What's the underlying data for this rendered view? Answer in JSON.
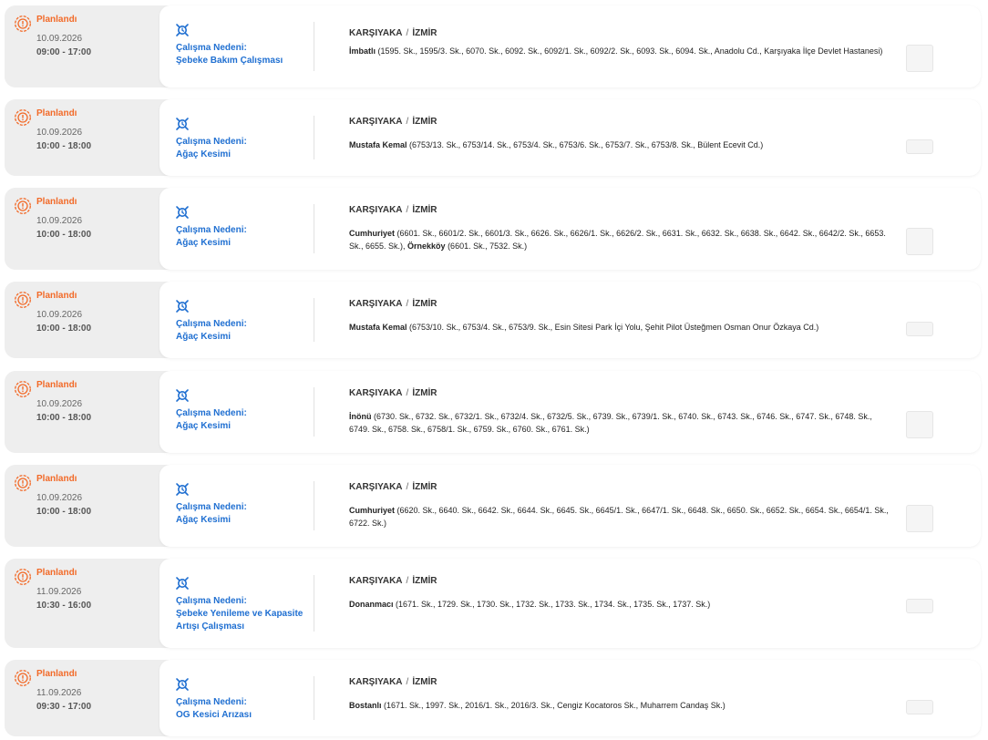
{
  "status_color": "#f26a28",
  "reason_color": "#1f6fd1",
  "location_sep": "/",
  "records": [
    {
      "status": "Planlandı",
      "status_icon": "gear-warning-icon",
      "date": "10.09.2026",
      "time": "09:00 - 17:00",
      "reason_label": "Çalışma Nedeni:",
      "reason_value": "Şebeke Bakım Çalışması",
      "reason_icon": "gear-clock-icon",
      "district": "KARŞIYAKA",
      "city": "İZMİR",
      "segments": [
        {
          "neighborhood": "İmbatlı",
          "streets": " (1595. Sk., 1595/3. Sk., 6070. Sk., 6092. Sk., 6092/1. Sk., 6092/2. Sk., 6093. Sk., 6094. Sk., Anadolu Cd., Karşıyaka İlçe Devlet Hastanesi)"
        }
      ]
    },
    {
      "status": "Planlandı",
      "status_icon": "gear-warning-icon",
      "date": "10.09.2026",
      "time": "10:00 - 18:00",
      "reason_label": "Çalışma Nedeni:",
      "reason_value": "Ağaç Kesimi",
      "reason_icon": "gear-clock-icon",
      "district": "KARŞIYAKA",
      "city": "İZMİR",
      "segments": [
        {
          "neighborhood": "Mustafa Kemal",
          "streets": " (6753/13. Sk., 6753/14. Sk., 6753/4. Sk., 6753/6. Sk., 6753/7. Sk., 6753/8. Sk., Bülent Ecevit Cd.)"
        }
      ]
    },
    {
      "status": "Planlandı",
      "status_icon": "gear-warning-icon",
      "date": "10.09.2026",
      "time": "10:00 - 18:00",
      "reason_label": "Çalışma Nedeni:",
      "reason_value": "Ağaç Kesimi",
      "reason_icon": "gear-clock-icon",
      "district": "KARŞIYAKA",
      "city": "İZMİR",
      "segments": [
        {
          "neighborhood": "Cumhuriyet",
          "streets": " (6601. Sk., 6601/2. Sk., 6601/3. Sk., 6626. Sk., 6626/1. Sk., 6626/2. Sk., 6631. Sk., 6632. Sk., 6638. Sk., 6642. Sk., 6642/2. Sk., 6653. Sk., 6655. Sk.),"
        },
        {
          "neighborhood": " Örnekköy",
          "streets": " (6601. Sk., 7532. Sk.)"
        }
      ]
    },
    {
      "status": "Planlandı",
      "status_icon": "gear-warning-icon",
      "date": "10.09.2026",
      "time": "10:00 - 18:00",
      "reason_label": "Çalışma Nedeni:",
      "reason_value": "Ağaç Kesimi",
      "reason_icon": "gear-clock-icon",
      "district": "KARŞIYAKA",
      "city": "İZMİR",
      "segments": [
        {
          "neighborhood": "Mustafa Kemal",
          "streets": " (6753/10. Sk., 6753/4. Sk., 6753/9. Sk., Esin Sitesi Park İçi Yolu, Şehit Pilot Üsteğmen Osman Onur Özkaya Cd.)"
        }
      ]
    },
    {
      "status": "Planlandı",
      "status_icon": "gear-warning-icon",
      "date": "10.09.2026",
      "time": "10:00 - 18:00",
      "reason_label": "Çalışma Nedeni:",
      "reason_value": "Ağaç Kesimi",
      "reason_icon": "gear-clock-icon",
      "district": "KARŞIYAKA",
      "city": "İZMİR",
      "segments": [
        {
          "neighborhood": "İnönü",
          "streets": " (6730. Sk., 6732. Sk., 6732/1. Sk., 6732/4. Sk., 6732/5. Sk., 6739. Sk., 6739/1. Sk., 6740. Sk., 6743. Sk., 6746. Sk., 6747. Sk., 6748. Sk., 6749. Sk., 6758. Sk., 6758/1. Sk., 6759. Sk., 6760. Sk., 6761. Sk.)"
        }
      ]
    },
    {
      "status": "Planlandı",
      "status_icon": "gear-warning-icon",
      "date": "10.09.2026",
      "time": "10:00 - 18:00",
      "reason_label": "Çalışma Nedeni:",
      "reason_value": "Ağaç Kesimi",
      "reason_icon": "gear-clock-icon",
      "district": "KARŞIYAKA",
      "city": "İZMİR",
      "segments": [
        {
          "neighborhood": "Cumhuriyet",
          "streets": " (6620. Sk., 6640. Sk., 6642. Sk., 6644. Sk., 6645. Sk., 6645/1. Sk., 6647/1. Sk., 6648. Sk., 6650. Sk., 6652. Sk., 6654. Sk., 6654/1. Sk., 6722. Sk.)"
        }
      ]
    },
    {
      "status": "Planlandı",
      "status_icon": "gear-warning-icon",
      "date": "11.09.2026",
      "time": "10:30 - 16:00",
      "reason_label": "Çalışma Nedeni:",
      "reason_value": "Şebeke Yenileme ve Kapasite Artışı Çalışması",
      "reason_icon": "gear-clock-icon",
      "district": "KARŞIYAKA",
      "city": "İZMİR",
      "segments": [
        {
          "neighborhood": "Donanmacı",
          "streets": " (1671. Sk., 1729. Sk., 1730. Sk., 1732. Sk., 1733. Sk., 1734. Sk., 1735. Sk., 1737. Sk.)"
        }
      ]
    },
    {
      "status": "Planlandı",
      "status_icon": "gear-warning-icon",
      "date": "11.09.2026",
      "time": "09:30 - 17:00",
      "reason_label": "Çalışma Nedeni:",
      "reason_value": "OG Kesici Arızası",
      "reason_icon": "gear-clock-icon",
      "district": "KARŞIYAKA",
      "city": "İZMİR",
      "segments": [
        {
          "neighborhood": "Bostanlı",
          "streets": " (1671. Sk., 1997. Sk., 2016/1. Sk., 2016/3. Sk., Cengiz Kocatoros Sk., Muharrem Candaş Sk.)"
        }
      ]
    }
  ]
}
